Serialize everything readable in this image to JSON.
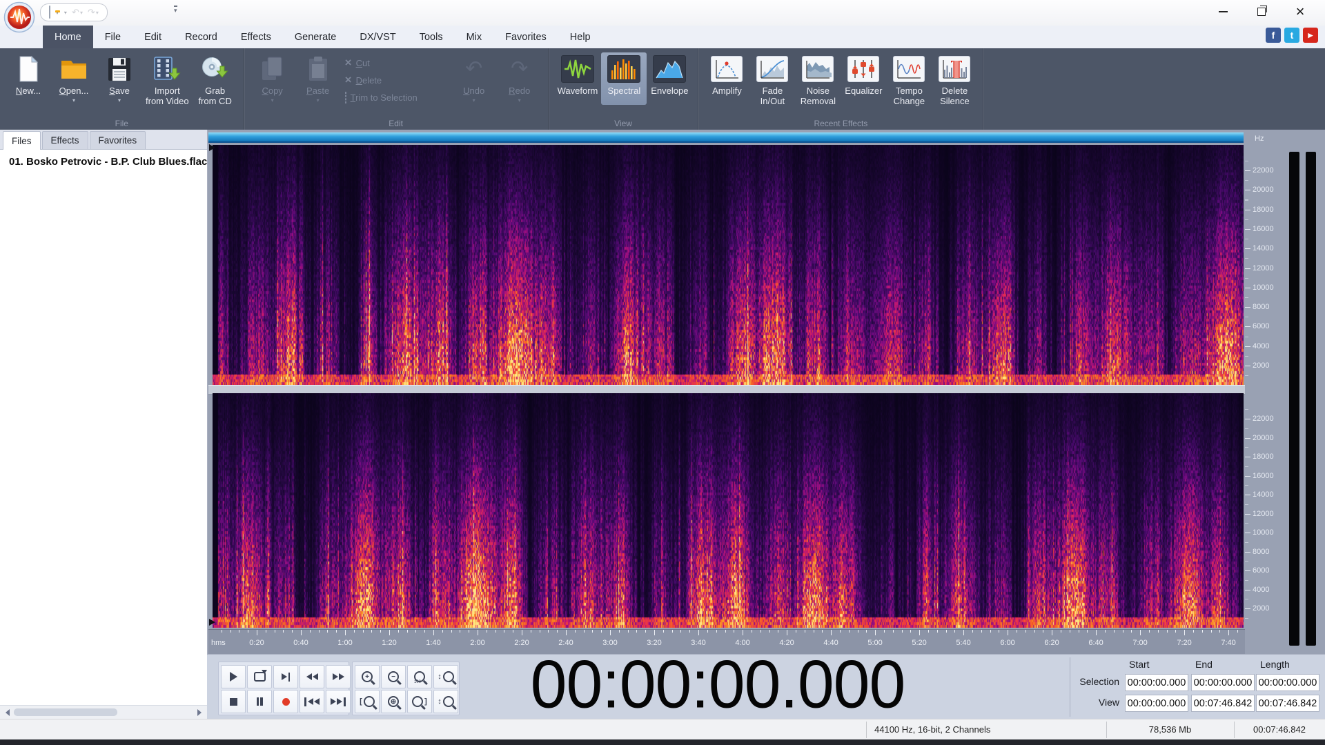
{
  "titlebar": {
    "qat_buttons": [
      {
        "name": "new",
        "icon": "new-doc-mini",
        "arrow": false,
        "disabled": false
      },
      {
        "name": "open",
        "icon": "open-folder-mini",
        "arrow": true,
        "disabled": false
      },
      {
        "name": "save",
        "icon": "save-mini",
        "arrow": true,
        "disabled": false
      },
      {
        "name": "undo",
        "icon": "undo-mini",
        "arrow": true,
        "disabled": true
      },
      {
        "name": "redo",
        "icon": "redo-mini",
        "arrow": true,
        "disabled": true
      }
    ],
    "window_controls": [
      "minimize",
      "maximize",
      "close"
    ]
  },
  "menu": {
    "tabs": [
      {
        "label": "Home",
        "active": true
      },
      {
        "label": "File"
      },
      {
        "label": "Edit"
      },
      {
        "label": "Record"
      },
      {
        "label": "Effects"
      },
      {
        "label": "Generate"
      },
      {
        "label": "DX/VST"
      },
      {
        "label": "Tools"
      },
      {
        "label": "Mix"
      },
      {
        "label": "Favorites"
      },
      {
        "label": "Help"
      }
    ],
    "social": [
      {
        "name": "facebook",
        "glyph": "f",
        "color": "#3a5a98"
      },
      {
        "name": "twitter",
        "glyph": "t",
        "color": "#29a9e1"
      },
      {
        "name": "youtube",
        "glyph": "▶",
        "color": "#d6271c"
      }
    ]
  },
  "ribbon": {
    "groups": [
      {
        "label": "File",
        "type": "buttons",
        "buttons": [
          {
            "lines": [
              "New..."
            ],
            "icon": "new-document",
            "mnemonic": true
          },
          {
            "lines": [
              "Open..."
            ],
            "icon": "open-folder",
            "arrow": true,
            "mnemonic": true
          },
          {
            "lines": [
              "Save"
            ],
            "icon": "save-floppy",
            "arrow": true,
            "mnemonic": true
          },
          {
            "lines": [
              "Import",
              "from Video"
            ],
            "icon": "import-video"
          },
          {
            "lines": [
              "Grab",
              "from CD"
            ],
            "icon": "grab-cd"
          }
        ]
      },
      {
        "label": "Edit",
        "type": "edit",
        "disabled": true,
        "big_left": [
          {
            "lines": [
              "Copy"
            ],
            "icon": "copy",
            "arrow": true,
            "mnemonic": true
          },
          {
            "lines": [
              "Paste"
            ],
            "icon": "paste",
            "arrow": true,
            "mnemonic": true
          }
        ],
        "smalls": [
          {
            "label": "Cut",
            "icon": "cut-x",
            "mnemonic": true
          },
          {
            "label": "Delete",
            "icon": "delete-x",
            "mnemonic": true
          },
          {
            "label": "Trim to Selection",
            "icon": "trim-rect",
            "mnemonic": true
          }
        ],
        "big_right": [
          {
            "lines": [
              "Undo"
            ],
            "icon": "undo-arrow",
            "arrow": true,
            "mnemonic": true
          },
          {
            "lines": [
              "Redo"
            ],
            "icon": "redo-arrow",
            "arrow": true,
            "mnemonic": true
          }
        ]
      },
      {
        "label": "View",
        "type": "buttons",
        "buttons": [
          {
            "lines": [
              "Waveform"
            ],
            "icon": "waveform-view"
          },
          {
            "lines": [
              "Spectral"
            ],
            "icon": "spectral-view",
            "selected": true
          },
          {
            "lines": [
              "Envelope"
            ],
            "icon": "envelope-view"
          }
        ]
      },
      {
        "label": "Recent Effects",
        "type": "buttons",
        "buttons": [
          {
            "lines": [
              "Amplify"
            ],
            "icon": "amplify"
          },
          {
            "lines": [
              "Fade",
              "In/Out"
            ],
            "icon": "fade-inout"
          },
          {
            "lines": [
              "Noise",
              "Removal"
            ],
            "icon": "noise-removal"
          },
          {
            "lines": [
              "Equalizer"
            ],
            "icon": "equalizer"
          },
          {
            "lines": [
              "Tempo",
              "Change"
            ],
            "icon": "tempo-change"
          },
          {
            "lines": [
              "Delete",
              "Silence"
            ],
            "icon": "delete-silence"
          }
        ]
      }
    ]
  },
  "sidebar": {
    "tabs": [
      {
        "label": "Files",
        "active": true
      },
      {
        "label": "Effects"
      },
      {
        "label": "Favorites"
      }
    ],
    "files": [
      "01. Bosko Petrovic - B.P. Club Blues.flac"
    ]
  },
  "spectral_view": {
    "unit": "Hz",
    "freq_labels": [
      "22000",
      "20000",
      "18000",
      "16000",
      "14000",
      "12000",
      "10000",
      "8000",
      "6000",
      "4000",
      "2000"
    ],
    "ruler": {
      "origin_label": "hms",
      "labels": [
        "0:20",
        "0:40",
        "1:00",
        "1:20",
        "1:40",
        "2:00",
        "2:20",
        "2:40",
        "3:00",
        "3:20",
        "3:40",
        "4:00",
        "4:20",
        "4:40",
        "5:00",
        "5:20",
        "5:40",
        "6:00",
        "6:20",
        "6:40",
        "7:00",
        "7:20",
        "7:40"
      ],
      "label_interval_s": 20,
      "minor_interval_s": 4,
      "duration_s": 466.842
    },
    "channels": 2
  },
  "transport": {
    "rows": [
      [
        "play",
        "loop",
        "play-to-end",
        "rewind",
        "fast-forward"
      ],
      [
        "stop",
        "pause",
        "record",
        "go-to-start",
        "go-to-end"
      ]
    ],
    "zoom_rows": [
      [
        "zoom-in",
        "zoom-out",
        "zoom-100",
        "zoom-vertical-in"
      ],
      [
        "zoom-selection-start",
        "zoom-all",
        "zoom-selection-end",
        "zoom-vertical-out"
      ]
    ]
  },
  "time_display": {
    "value": "00:00:00.000"
  },
  "selection_grid": {
    "col_headers": [
      "Start",
      "End",
      "Length"
    ],
    "rows": [
      {
        "label": "Selection",
        "values": [
          "00:00:00.000",
          "00:00:00.000",
          "00:00:00.000"
        ]
      },
      {
        "label": "View",
        "values": [
          "00:00:00.000",
          "00:07:46.842",
          "00:07:46.842"
        ]
      }
    ]
  },
  "status_bar": {
    "format": "44100 Hz, 16-bit, 2 Channels",
    "size": "78,536 Mb",
    "duration": "00:07:46.842"
  },
  "colors": {
    "accent_blue": "#1583c7",
    "ribbon_bg": "#4d5667",
    "record_red": "#e23c28",
    "panel_gray": "#99a1b3",
    "spectro_low": "#0d0619",
    "spectro_high": "#ffe482"
  }
}
